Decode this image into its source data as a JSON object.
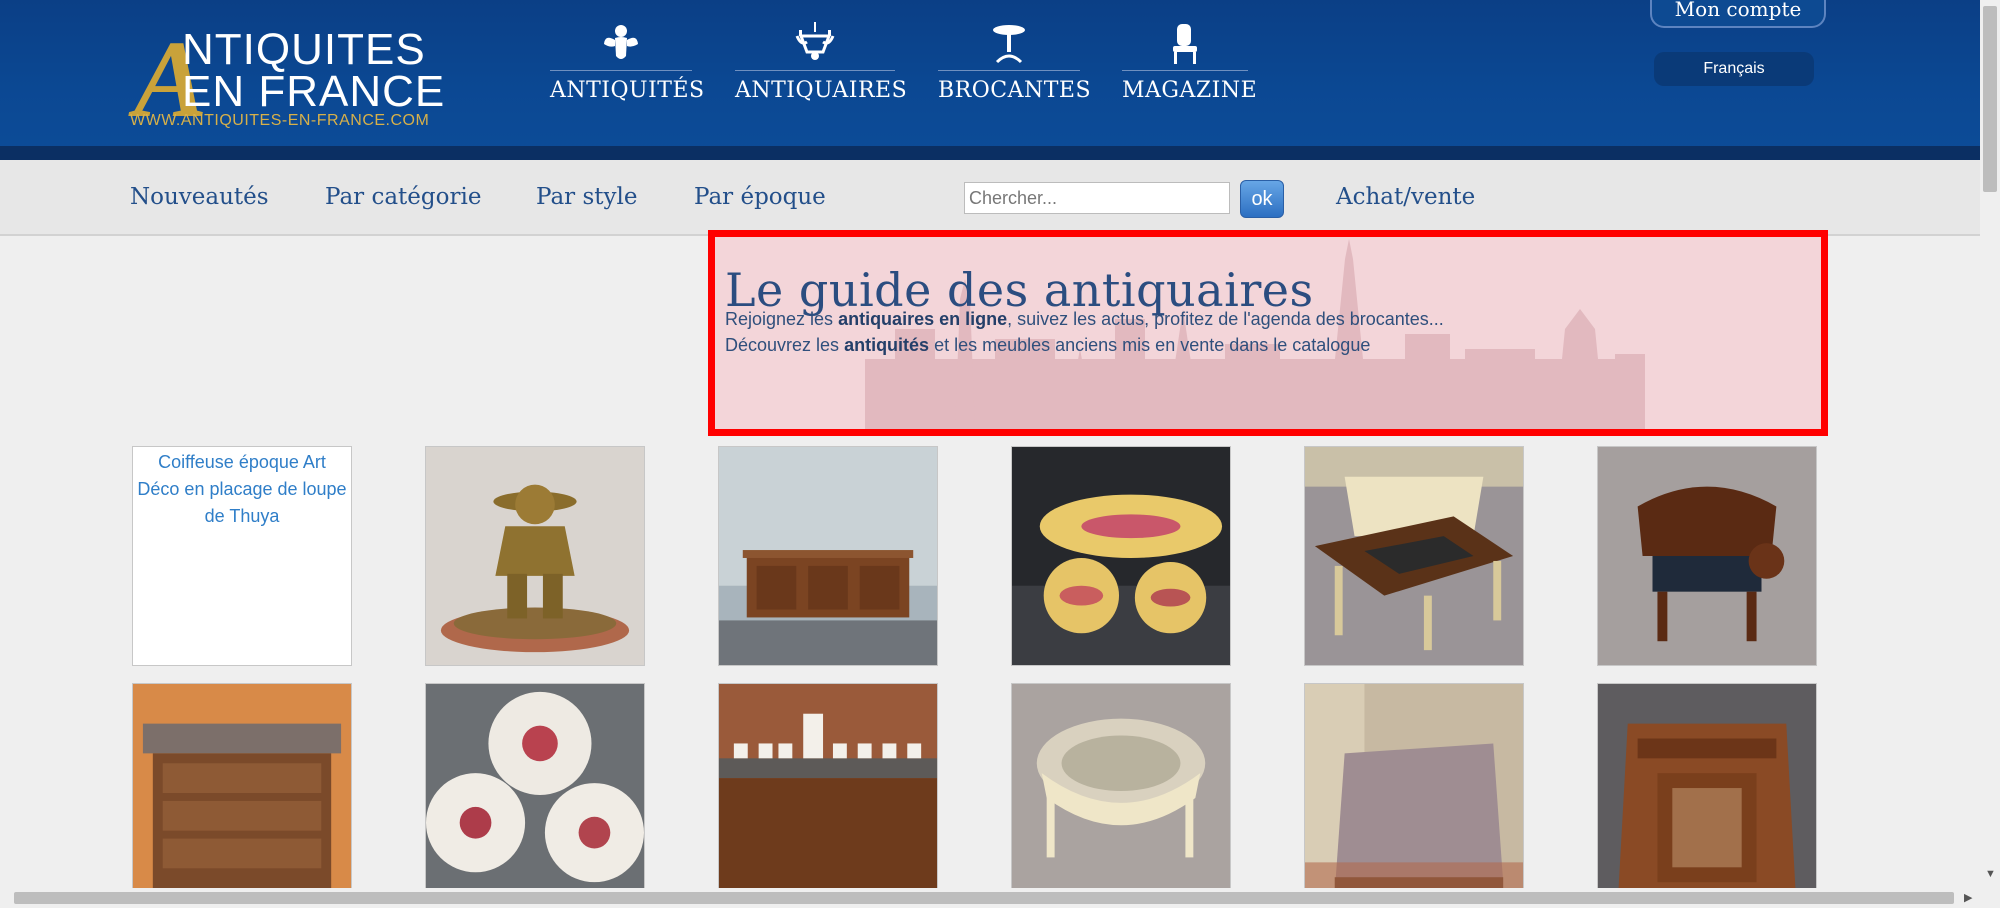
{
  "logo": {
    "letter": "A",
    "line1": "NTIQUITES",
    "line2": "EN FRANCE",
    "url": "WWW.ANTIQUITES-EN-FRANCE.COM"
  },
  "main_nav": [
    {
      "label": "ANTIQUITÉS",
      "icon": "cherub-icon"
    },
    {
      "label": "ANTIQUAIRES",
      "icon": "chandelier-icon"
    },
    {
      "label": "BROCANTES",
      "icon": "table-icon"
    },
    {
      "label": "MAGAZINE",
      "icon": "chair-icon"
    }
  ],
  "account": {
    "label": "Mon compte"
  },
  "language": {
    "label": "Français"
  },
  "sub_nav": {
    "items": [
      "Nouveautés",
      "Par catégorie",
      "Par style",
      "Par époque"
    ],
    "search_placeholder": "Chercher...",
    "search_button": "ok",
    "buy_sell": "Achat/vente"
  },
  "hero": {
    "title": "Le guide des antiquaires",
    "line1_before": "Rejoignez les ",
    "line1_bold": "antiquaires en ligne",
    "line1_after": ", suivez les actus, profitez de l'agenda des brocantes...",
    "line2_before": "Découvrez les ",
    "line2_bold": "antiquités",
    "line2_after": " et les meubles anciens mis en vente dans le catalogue"
  },
  "products_row1": [
    {
      "alt": "Coiffeuse époque Art Déco en placage de loupe de Thuya",
      "image_loaded": false
    },
    {
      "image": "bronze-figure"
    },
    {
      "image": "sideboard"
    },
    {
      "image": "fish-plates"
    },
    {
      "image": "game-table"
    },
    {
      "image": "armchair"
    }
  ],
  "products_row2": [
    {
      "image": "marble-commode"
    },
    {
      "image": "porcelain-plates"
    },
    {
      "image": "tea-set-cabinet"
    },
    {
      "image": "footstool"
    },
    {
      "image": "marble-table"
    },
    {
      "image": "inlaid-cabinet"
    }
  ],
  "colors": {
    "header_blue": "#0b4893",
    "link_blue": "#234f8a",
    "gold": "#c9a23a",
    "highlight_red": "#ff0000"
  }
}
